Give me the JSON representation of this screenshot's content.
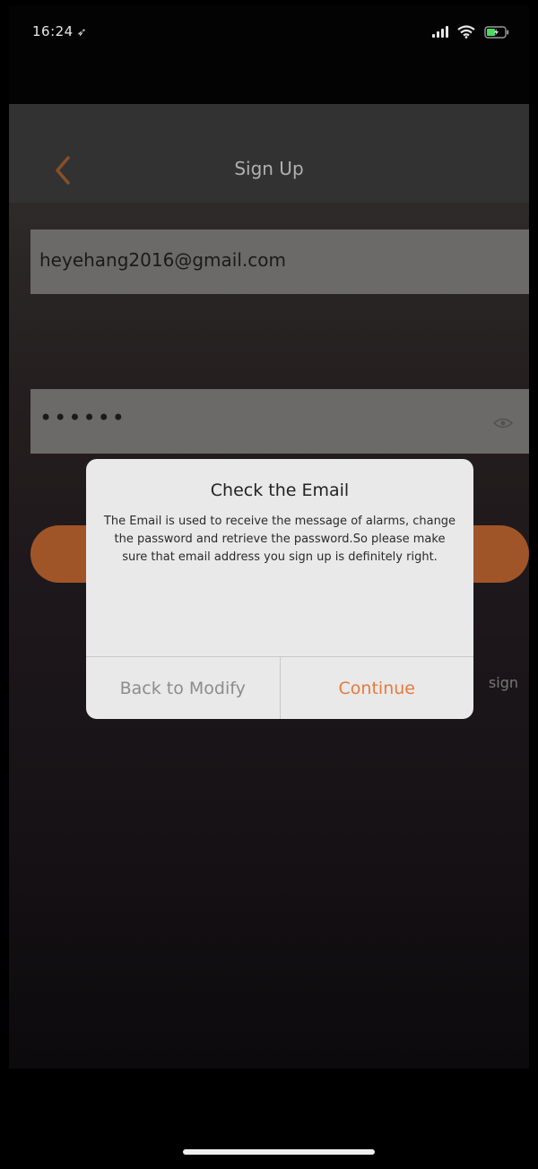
{
  "status_bar": {
    "time": "16:24",
    "location_arrow": "location-arrow-icon",
    "signal": "cellular-signal-icon",
    "wifi": "wifi-icon",
    "battery": "battery-charging-icon"
  },
  "nav": {
    "title": "Sign Up",
    "back_icon": "chevron-left-icon"
  },
  "form": {
    "email_value": "heyehang2016@gmail.com",
    "password_mask": "••••••",
    "eye_icon": "eye-icon"
  },
  "background_text": {
    "sign": "sign"
  },
  "dialog": {
    "title": "Check the Email",
    "message": "The Email is used to receive the message of alarms, change the password and retrieve the password.So please make sure that email address you sign up is definitely right.",
    "back_label": "Back to Modify",
    "continue_label": "Continue"
  },
  "colors": {
    "accent": "#e77a3a",
    "dialog_bg": "#e9e9ea",
    "field_bg": "#7b7878"
  }
}
